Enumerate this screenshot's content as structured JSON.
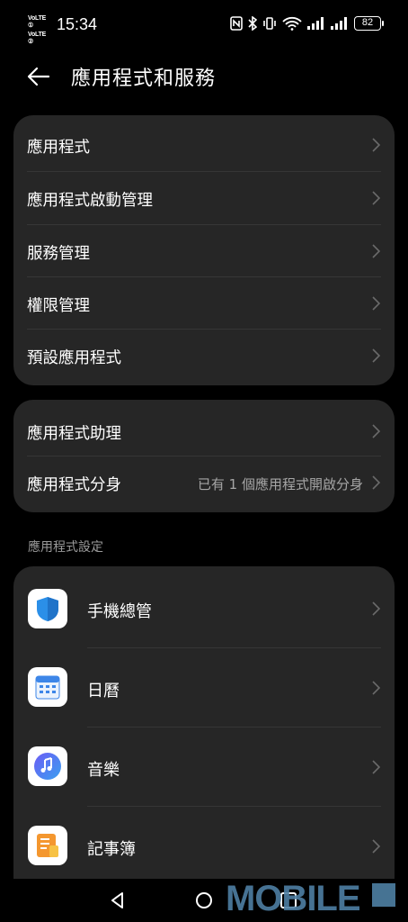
{
  "status_bar": {
    "volte_1": "VoLTE ①",
    "volte_2": "VoLTE ②",
    "time": "15:34",
    "battery": "82"
  },
  "header": {
    "title": "應用程式和服務"
  },
  "group1": {
    "items": [
      {
        "label": "應用程式"
      },
      {
        "label": "應用程式啟動管理"
      },
      {
        "label": "服務管理"
      },
      {
        "label": "權限管理"
      },
      {
        "label": "預設應用程式"
      }
    ]
  },
  "group2": {
    "items": [
      {
        "label": "應用程式助理",
        "value": ""
      },
      {
        "label": "應用程式分身",
        "value": "已有 1 個應用程式開啟分身"
      }
    ]
  },
  "app_settings": {
    "section_label": "應用程式設定",
    "apps": [
      {
        "label": "手機總管",
        "icon": "phone-manager-icon"
      },
      {
        "label": "日曆",
        "icon": "calendar-icon"
      },
      {
        "label": "音樂",
        "icon": "music-icon"
      },
      {
        "label": "記事簿",
        "icon": "notepad-icon"
      }
    ]
  },
  "watermark": {
    "text": "MOBILE"
  }
}
